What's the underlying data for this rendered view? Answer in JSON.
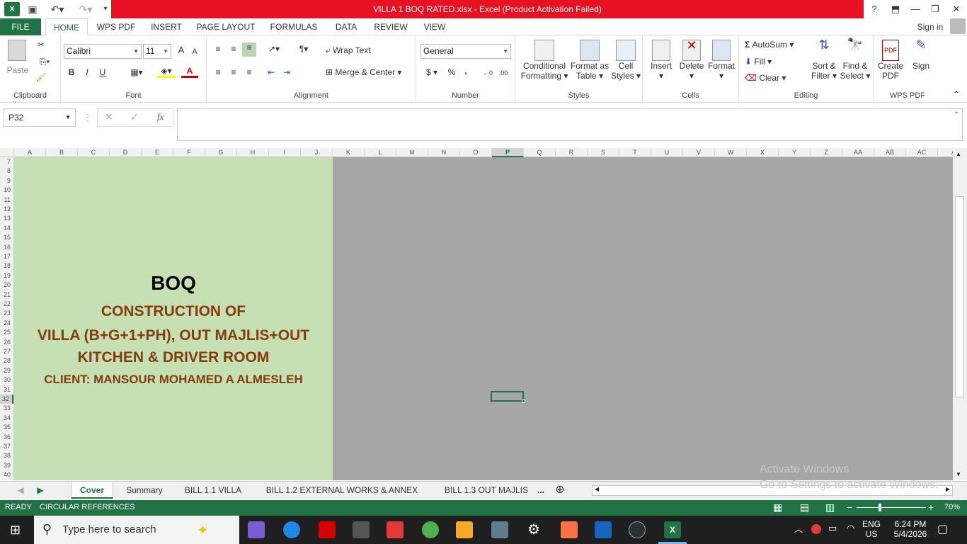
{
  "window": {
    "title": "VILLA 1 BOQ RATED.xlsx -  Excel (Product Activation Failed)",
    "help_icon": "?",
    "min": "—",
    "restore": "❐",
    "close": "✕"
  },
  "tabs": {
    "file": "FILE",
    "items": [
      "HOME",
      "WPS PDF",
      "INSERT",
      "PAGE LAYOUT",
      "FORMULAS",
      "DATA",
      "REVIEW",
      "VIEW"
    ],
    "sign_in": "Sign in"
  },
  "ribbon": {
    "clipboard": {
      "label": "Clipboard",
      "paste": "Paste"
    },
    "font": {
      "label": "Font",
      "name": "Calibri",
      "size": "11",
      "bold": "B",
      "italic": "I",
      "underline": "U"
    },
    "alignment": {
      "label": "Alignment",
      "wrap": "Wrap Text",
      "merge": "Merge & Center"
    },
    "number": {
      "label": "Number",
      "format": "General",
      "currency": "$",
      "percent": "%",
      "comma": ","
    },
    "styles": {
      "label": "Styles",
      "cond1": "Conditional",
      "cond2": "Formatting",
      "fmt1": "Format as",
      "fmt2": "Table",
      "cell1": "Cell",
      "cell2": "Styles"
    },
    "cells": {
      "label": "Cells",
      "insert": "Insert",
      "delete": "Delete",
      "format": "Format"
    },
    "editing": {
      "label": "Editing",
      "autosum": "AutoSum",
      "fill": "Fill",
      "clear": "Clear",
      "sort1": "Sort &",
      "sort2": "Filter",
      "find1": "Find &",
      "find2": "Select"
    },
    "wpspdf": {
      "label": "WPS PDF",
      "create1": "Create",
      "create2": "PDF",
      "sign": "Sign"
    }
  },
  "formula_bar": {
    "name_box": "P32",
    "fx": "fx",
    "value": ""
  },
  "columns": [
    "A",
    "B",
    "C",
    "D",
    "E",
    "F",
    "G",
    "H",
    "I",
    "J",
    "K",
    "L",
    "M",
    "N",
    "O",
    "P",
    "Q",
    "R",
    "S",
    "T",
    "U",
    "V",
    "W",
    "X",
    "Y",
    "Z",
    "AA",
    "AB",
    "AC",
    "A"
  ],
  "selected_column": "P",
  "rows": [
    "7",
    "8",
    "9",
    "10",
    "11",
    "12",
    "13",
    "14",
    "15",
    "16",
    "17",
    "18",
    "19",
    "20",
    "21",
    "22",
    "23",
    "24",
    "25",
    "26",
    "27",
    "28",
    "29",
    "30",
    "31",
    "32",
    "33",
    "34",
    "35",
    "36",
    "37",
    "38",
    "39",
    "40"
  ],
  "selected_row": "32",
  "cover": {
    "heading": "BOQ",
    "line1": "CONSTRUCTION OF",
    "line2": "VILLA (B+G+1+PH), OUT MAJLIS+OUT",
    "line3": "KITCHEN & DRIVER ROOM",
    "line4": "CLIENT: MANSOUR MOHAMED A ALMESLEH",
    "heading_color": "#000000",
    "text_color": "#843c0c",
    "bg_color": "#c6e0b4"
  },
  "sheets": [
    "Cover",
    "Summary",
    "BILL 1.1 VILLA",
    "BILL 1.2 EXTERNAL WORKS & ANNEX",
    "BILL 1.3 OUT MAJLIS"
  ],
  "active_sheet": "Cover",
  "more_sheets": "...",
  "status": {
    "ready": "READY",
    "circular": "CIRCULAR REFERENCES",
    "zoom": "70%"
  },
  "watermark": {
    "line1": "Activate Windows",
    "line2": "Go to Settings to activate Windows."
  },
  "taskbar": {
    "search": "Type here to search",
    "lang1": "ENG",
    "lang2": "US",
    "time": "6:24 PM",
    "date": "5/4/2026"
  },
  "colors": {
    "excel_green": "#217346",
    "title_red": "#e81123",
    "grey_area": "#a6a6a6"
  }
}
